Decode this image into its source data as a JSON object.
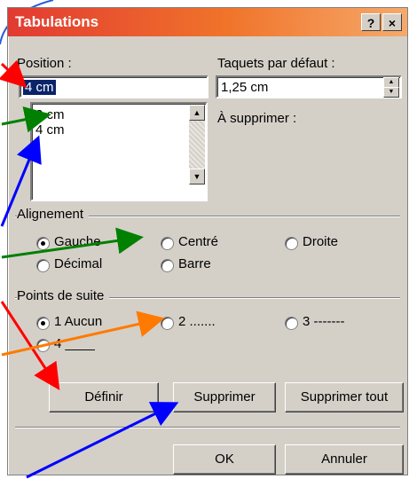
{
  "dialog": {
    "title": "Tabulations",
    "help_button": "?",
    "close_button": "×"
  },
  "position": {
    "label": "Position :",
    "value": "4 cm",
    "list": [
      "2 cm",
      "4 cm"
    ]
  },
  "default_tabs": {
    "label": "Taquets par défaut :",
    "value": "1,25 cm"
  },
  "to_delete": {
    "label": "À supprimer :"
  },
  "alignment": {
    "title": "Alignement",
    "options": [
      {
        "label": "Gauche",
        "selected": true
      },
      {
        "label": "Centré",
        "selected": false
      },
      {
        "label": "Droite",
        "selected": false
      },
      {
        "label": "Décimal",
        "selected": false
      },
      {
        "label": "Barre",
        "selected": false
      }
    ]
  },
  "leader": {
    "title": "Points de suite",
    "options": [
      {
        "label": "1 Aucun",
        "selected": true
      },
      {
        "label": "2 .......",
        "selected": false
      },
      {
        "label": "3 -------",
        "selected": false
      },
      {
        "label": "4 ____",
        "selected": false
      }
    ]
  },
  "buttons": {
    "define": "Définir",
    "delete": "Supprimer",
    "delete_all": "Supprimer tout",
    "ok": "OK",
    "cancel": "Annuler"
  },
  "colors": {
    "title_start": "#e23a32",
    "title_end": "#f6a96b",
    "dialog_face": "#d4d0c8",
    "selection": "#0a246a",
    "arrow_red": "#ff0000",
    "arrow_green": "#008000",
    "arrow_blue": "#0000ff",
    "arrow_orange": "#ff7a00"
  }
}
